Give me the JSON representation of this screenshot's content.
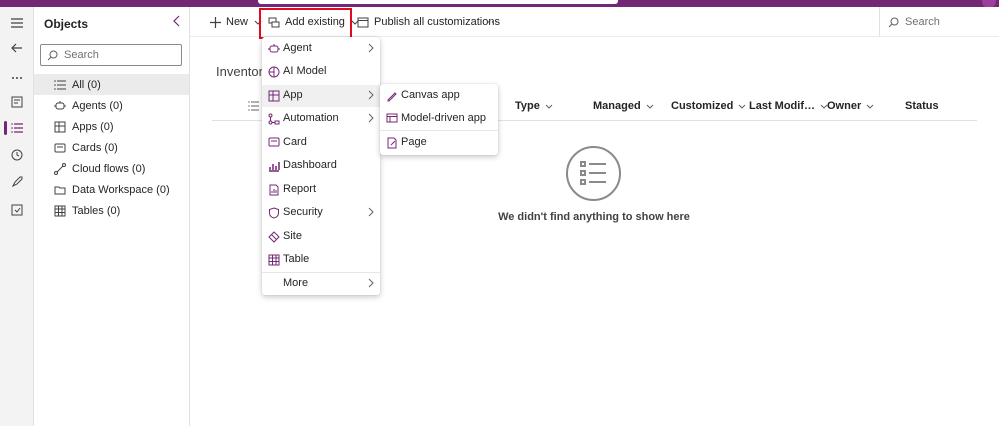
{
  "colors": {
    "brand": "#742774",
    "highlight": "#e00b1c"
  },
  "objects_panel": {
    "title": "Objects",
    "search_placeholder": "Search",
    "items": [
      {
        "label": "All",
        "count": "(0)",
        "icon": "list-icon"
      },
      {
        "label": "Agents",
        "count": "(0)",
        "icon": "agent-icon"
      },
      {
        "label": "Apps",
        "count": "(0)",
        "icon": "apps-icon"
      },
      {
        "label": "Cards",
        "count": "(0)",
        "icon": "card-icon"
      },
      {
        "label": "Cloud flows",
        "count": "(0)",
        "icon": "flow-icon"
      },
      {
        "label": "Data Workspace",
        "count": "(0)",
        "icon": "folder-icon"
      },
      {
        "label": "Tables",
        "count": "(0)",
        "icon": "table-icon"
      }
    ]
  },
  "toolbar": {
    "new_label": "New",
    "add_existing_label": "Add existing",
    "publish_label": "Publish all customizations",
    "more_label": "···",
    "search_placeholder": "Search"
  },
  "main": {
    "title": "Inventory",
    "columns": [
      "Type",
      "Managed",
      "Customized",
      "Last Modif…",
      "Owner",
      "Status"
    ],
    "empty_message": "We didn't find anything to show here"
  },
  "add_existing_menu": {
    "items": [
      {
        "label": "Agent",
        "icon": "agent-icon",
        "submenu": true
      },
      {
        "label": "AI Model",
        "icon": "ai-model-icon",
        "submenu": false
      },
      {
        "label": "App",
        "icon": "app-icon",
        "submenu": true
      },
      {
        "label": "Automation",
        "icon": "automation-icon",
        "submenu": true
      },
      {
        "label": "Card",
        "icon": "card-icon",
        "submenu": false
      },
      {
        "label": "Dashboard",
        "icon": "dashboard-icon",
        "submenu": false
      },
      {
        "label": "Report",
        "icon": "report-icon",
        "submenu": false
      },
      {
        "label": "Security",
        "icon": "security-icon",
        "submenu": true
      },
      {
        "label": "Site",
        "icon": "site-icon",
        "submenu": false
      },
      {
        "label": "Table",
        "icon": "table-icon",
        "submenu": false
      },
      {
        "label": "More",
        "icon": "",
        "submenu": true
      }
    ]
  },
  "app_submenu": {
    "items": [
      {
        "label": "Canvas app",
        "icon": "canvas-app-icon"
      },
      {
        "label": "Model-driven app",
        "icon": "model-driven-app-icon"
      },
      {
        "label": "Page",
        "icon": "page-icon"
      }
    ]
  }
}
